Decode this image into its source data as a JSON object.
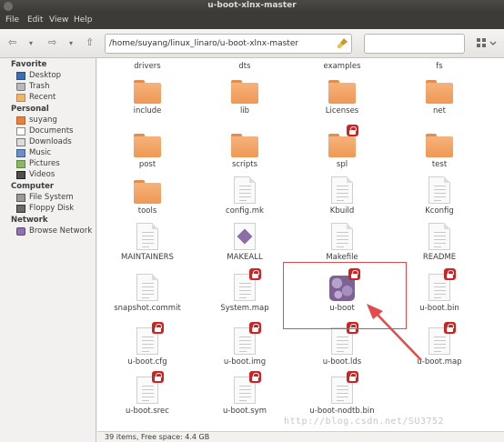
{
  "window": {
    "title": "u-boot-xlnx-master"
  },
  "menu": {
    "file": "File",
    "edit": "Edit",
    "view": "View",
    "help": "Help"
  },
  "toolbar": {
    "path": "/home/suyang/linux_linaro/u-boot-xlnx-master",
    "search_placeholder": ""
  },
  "sidebar": {
    "favorite": {
      "heading": "Favorite",
      "items": [
        {
          "label": "Desktop",
          "icon": "desktop-icon"
        },
        {
          "label": "Trash",
          "icon": "trash-icon"
        },
        {
          "label": "Recent",
          "icon": "recent-icon"
        }
      ]
    },
    "personal": {
      "heading": "Personal",
      "items": [
        {
          "label": "suyang",
          "icon": "home-icon"
        },
        {
          "label": "Documents",
          "icon": "documents-icon"
        },
        {
          "label": "Downloads",
          "icon": "downloads-icon"
        },
        {
          "label": "Music",
          "icon": "music-icon"
        },
        {
          "label": "Pictures",
          "icon": "pictures-icon"
        },
        {
          "label": "Videos",
          "icon": "videos-icon"
        }
      ]
    },
    "computer": {
      "heading": "Computer",
      "items": [
        {
          "label": "File System",
          "icon": "filesystem-icon"
        },
        {
          "label": "Floppy Disk",
          "icon": "floppy-icon"
        }
      ]
    },
    "network": {
      "heading": "Network",
      "items": [
        {
          "label": "Browse Network",
          "icon": "network-icon"
        }
      ]
    }
  },
  "files": [
    {
      "name": "drivers",
      "type": "folder-partial",
      "locked": false
    },
    {
      "name": "dts",
      "type": "folder-partial",
      "locked": false
    },
    {
      "name": "examples",
      "type": "folder-partial",
      "locked": false
    },
    {
      "name": "fs",
      "type": "folder-partial",
      "locked": false
    },
    {
      "name": "include",
      "type": "folder",
      "locked": false
    },
    {
      "name": "lib",
      "type": "folder",
      "locked": false
    },
    {
      "name": "Licenses",
      "type": "folder",
      "locked": false
    },
    {
      "name": "net",
      "type": "folder",
      "locked": false
    },
    {
      "name": "post",
      "type": "folder",
      "locked": false
    },
    {
      "name": "scripts",
      "type": "folder",
      "locked": false
    },
    {
      "name": "spl",
      "type": "folder",
      "locked": true
    },
    {
      "name": "test",
      "type": "folder",
      "locked": false
    },
    {
      "name": "tools",
      "type": "folder",
      "locked": false
    },
    {
      "name": "config.mk",
      "type": "doc",
      "locked": false
    },
    {
      "name": "Kbuild",
      "type": "doc",
      "locked": false
    },
    {
      "name": "Kconfig",
      "type": "doc",
      "locked": false
    },
    {
      "name": "MAINTAINERS",
      "type": "doc",
      "locked": false
    },
    {
      "name": "MAKEALL",
      "type": "script",
      "locked": false
    },
    {
      "name": "Makefile",
      "type": "doc",
      "locked": false
    },
    {
      "name": "README",
      "type": "doc",
      "locked": false
    },
    {
      "name": "snapshot.commit",
      "type": "doc",
      "locked": false
    },
    {
      "name": "System.map",
      "type": "doc",
      "locked": true
    },
    {
      "name": "u-boot",
      "type": "exec",
      "locked": true
    },
    {
      "name": "u-boot.bin",
      "type": "doc",
      "locked": true
    },
    {
      "name": "u-boot.cfg",
      "type": "doc",
      "locked": true
    },
    {
      "name": "u-boot.img",
      "type": "doc",
      "locked": true
    },
    {
      "name": "u-boot.lds",
      "type": "doc",
      "locked": true
    },
    {
      "name": "u-boot.map",
      "type": "doc",
      "locked": true
    },
    {
      "name": "u-boot.srec",
      "type": "doc",
      "locked": true
    },
    {
      "name": "u-boot.sym",
      "type": "doc",
      "locked": true
    },
    {
      "name": "u-boot-nodtb.bin",
      "type": "doc",
      "locked": true
    }
  ],
  "annotation": {
    "highlight_color": "#e44a4a"
  },
  "status": {
    "text": "39 items, Free space: 4.4 GB"
  },
  "watermark": "http://blog.csdn.net/SU3752"
}
